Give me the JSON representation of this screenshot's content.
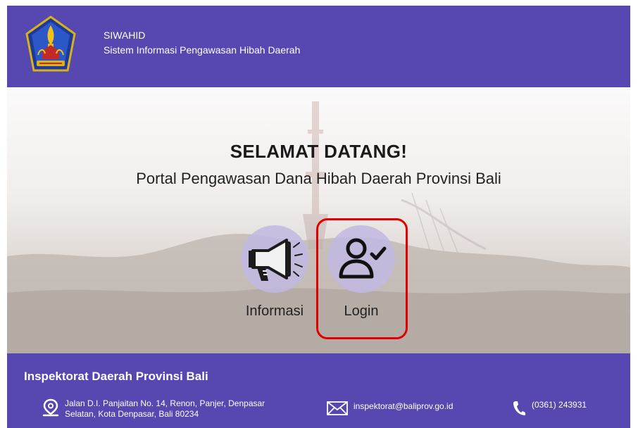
{
  "header": {
    "app_name": "SIWAHID",
    "app_subtitle": "Sistem Informasi Pengawasan Hibah Daerah",
    "logo_icon": "bali-province-emblem-icon"
  },
  "hero": {
    "welcome": "SELAMAT DATANG!",
    "tagline": "Portal Pengawasan Dana Hibah Daerah Provinsi Bali",
    "menu": [
      {
        "label": "Informasi",
        "icon": "megaphone-icon"
      },
      {
        "label": "Login",
        "icon": "user-check-icon",
        "highlighted": true
      }
    ]
  },
  "footer": {
    "title": "Inspektorat Daerah Provinsi Bali",
    "address_line1": "Jalan D.I. Panjaitan No. 14, Renon, Panjer, Denpasar",
    "address_line2": "Selatan, Kota Denpasar, Bali 80234",
    "email": "inspektorat@baliprov.go.id",
    "phone": "(0361) 243931"
  },
  "colors": {
    "brand": "#5747b0",
    "circle": "#c1b8e2",
    "highlight": "#e00000"
  }
}
